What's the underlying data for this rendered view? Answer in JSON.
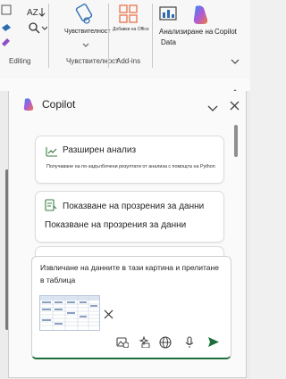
{
  "ribbon": {
    "editing_label": "Editing",
    "sensitivity_label": "Чувствителност",
    "sensitivity_group_label": "Чувствителност",
    "addins_small_label": "Добавки на Office",
    "addins_group_label": "Add-ins",
    "analyze_label_line1": "Анализиране на",
    "analyze_label_line2": "Data",
    "copilot_label": "Copilot",
    "collapse_icon": "chevron-down-icon"
  },
  "copilot": {
    "title": "Copilot",
    "cards": [
      {
        "title": "Разширен анализ",
        "subtitle": "Получаване на по-задълбочени резултати от анализа с помощта на Python"
      },
      {
        "title": "Показване на прозрения за данни",
        "subtitle": "Показване на прозрения за данни"
      }
    ],
    "composer": {
      "prompt_line1": "Извличане на данните в тази картина и прелитане",
      "prompt_line2": "в таблица"
    }
  },
  "colors": {
    "send_green": "#1e6e3c",
    "accent_blue": "#2b6cb0",
    "orange": "#e8734a"
  }
}
